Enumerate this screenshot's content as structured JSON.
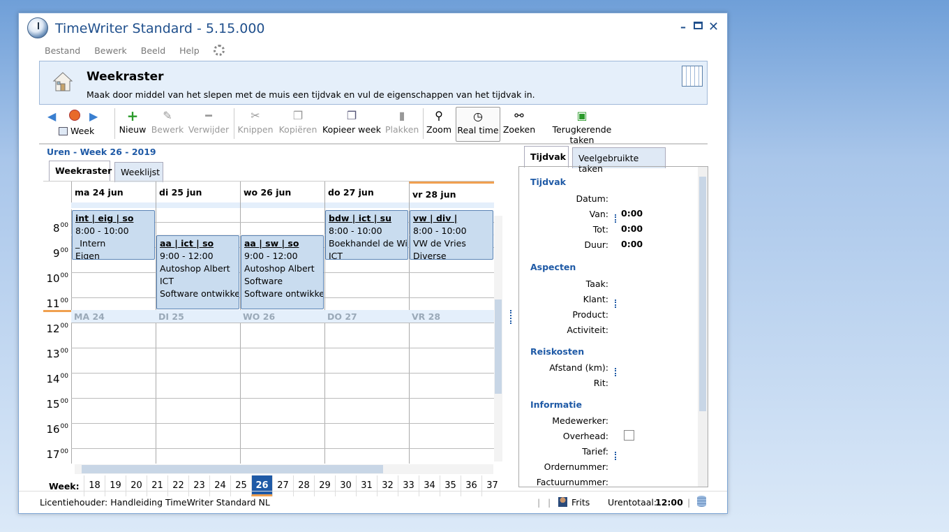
{
  "window": {
    "title": "TimeWriter Standard - 5.15.000"
  },
  "menu": [
    "Bestand",
    "Bewerk",
    "Beeld",
    "Help"
  ],
  "header": {
    "title": "Weekraster",
    "description": "Maak door middel van het slepen met de muis een tijdvak en vul de eigenschappen van het tijdvak in."
  },
  "toolbar": {
    "week": "Week",
    "nieuw": "Nieuw",
    "bewerk": "Bewerk",
    "verwijder": "Verwijder",
    "knippen": "Knippen",
    "kopieren": "Kopiëren",
    "kopieer_week": "Kopieer week",
    "plakken": "Plakken",
    "zoom": "Zoom",
    "realtime": "Real time",
    "zoeken": "Zoeken",
    "terugkerend": "Terugkerende taken"
  },
  "week_label": "Uren - Week 26 - 2019",
  "tabs": {
    "weekraster": "Weekraster",
    "weeklijst": "Weeklijst"
  },
  "days": [
    "ma 24 jun",
    "di 25 jun",
    "wo 26 jun",
    "do 27 jun",
    "vr 28 jun"
  ],
  "day_band": [
    "MA 24",
    "DI 25",
    "WO 26",
    "DO 27",
    "VR 28"
  ],
  "hours": [
    "8",
    "9",
    "10",
    "11",
    "12",
    "13",
    "14",
    "15",
    "16",
    "17"
  ],
  "minutes": "00",
  "appointments": [
    {
      "code": "int | eig | so",
      "time": "8:00 - 10:00",
      "l1": "_Intern",
      "l2": "Eigen",
      "l3": ""
    },
    {
      "code": "aa | ict | so",
      "time": "9:00 - 12:00",
      "l1": "Autoshop Albert",
      "l2": "ICT",
      "l3": "Software ontwikkeli"
    },
    {
      "code": "aa | sw | so",
      "time": "9:00 - 12:00",
      "l1": "Autoshop Albert",
      "l2": "Software",
      "l3": "Software ontwikkeli"
    },
    {
      "code": "bdw | ict | su",
      "time": "8:00 - 10:00",
      "l1": "Boekhandel de Win",
      "l2": "ICT",
      "l3": ""
    },
    {
      "code": "vw | div |",
      "time": "8:00 - 10:00",
      "l1": "VW de Vries",
      "l2": "Diverse",
      "l3": ""
    }
  ],
  "weekbar": {
    "label": "Week:",
    "weeks": [
      "18",
      "19",
      "20",
      "21",
      "22",
      "23",
      "24",
      "25",
      "26",
      "27",
      "28",
      "29",
      "30",
      "31",
      "32",
      "33",
      "34",
      "35",
      "36",
      "37"
    ],
    "current": "26"
  },
  "right_tabs": {
    "tijdvak": "Tijdvak",
    "veelgebruikt": "Veelgebruikte taken"
  },
  "props": {
    "tijdvak": "Tijdvak",
    "datum": "Datum:",
    "van": "Van:",
    "tot": "Tot:",
    "duur": "Duur:",
    "van_val": "0:00",
    "tot_val": "0:00",
    "duur_val": "0:00",
    "aspecten": "Aspecten",
    "taak": "Taak:",
    "klant": "Klant:",
    "product": "Product:",
    "activiteit": "Activiteit:",
    "reiskosten": "Reiskosten",
    "afstand": "Afstand (km):",
    "rit": "Rit:",
    "informatie": "Informatie",
    "medewerker": "Medewerker:",
    "overhead": "Overhead:",
    "tarief": "Tarief:",
    "ordernummer": "Ordernummer:",
    "factuurnummer": "Factuurnummer:"
  },
  "status": {
    "licentie": "Licentiehouder: Handleiding TimeWriter Standard NL",
    "user": "Frits",
    "urentotaal_label": "Urentotaal:",
    "urentotaal": "12:00"
  }
}
